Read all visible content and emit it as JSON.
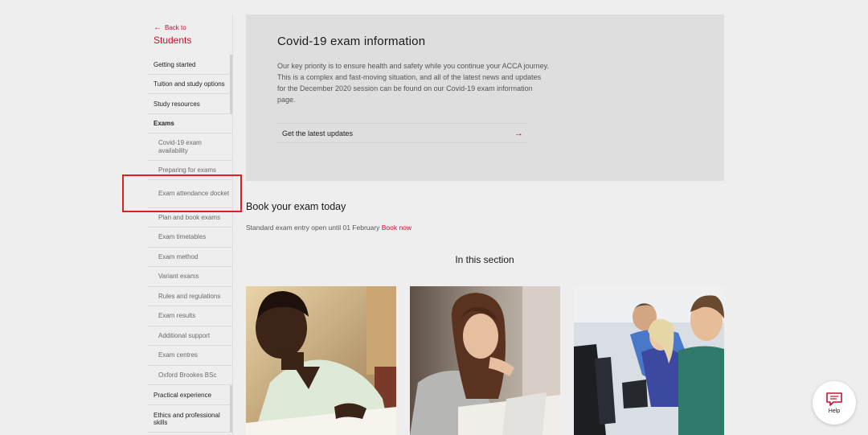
{
  "sidebar": {
    "back_label": "Back to",
    "section_title": "Students",
    "items": [
      {
        "label": "Getting started"
      },
      {
        "label": "Tuition and study options"
      },
      {
        "label": "Study resources"
      },
      {
        "label": "Exams"
      },
      {
        "label": "Covid-19 exam availability"
      },
      {
        "label": "Preparing for exams"
      },
      {
        "label": "Exam attendance docket"
      },
      {
        "label": "Plan and book exams"
      },
      {
        "label": "Exam timetables"
      },
      {
        "label": "Exam method"
      },
      {
        "label": "Variant exams"
      },
      {
        "label": "Rules and regulations"
      },
      {
        "label": "Exam results"
      },
      {
        "label": "Additional support"
      },
      {
        "label": "Exam centres"
      },
      {
        "label": "Oxford Brookes BSc"
      },
      {
        "label": "Practical experience"
      },
      {
        "label": "Ethics and professional skills"
      }
    ]
  },
  "hero": {
    "title": "Covid-19 exam information",
    "body": "Our key priority is to ensure health and safety while you continue your ACCA journey. This is a complex and fast-moving situation, and all of the latest news and updates for the December 2020 session can be found on our Covid-19 exam information page.",
    "cta_label": "Get the latest updates"
  },
  "book": {
    "title": "Book your exam today",
    "text": "Standard exam entry open until 01 February",
    "link": "Book now"
  },
  "in_section_title": "In this section",
  "help": {
    "label": "Help"
  },
  "colors": {
    "accent": "#c8102e",
    "highlight": "#e02020",
    "hero_bg": "#dedede",
    "page_bg": "#efeeee"
  },
  "icons": [
    "left-arrow-icon",
    "right-arrow-icon",
    "chat-icon"
  ]
}
